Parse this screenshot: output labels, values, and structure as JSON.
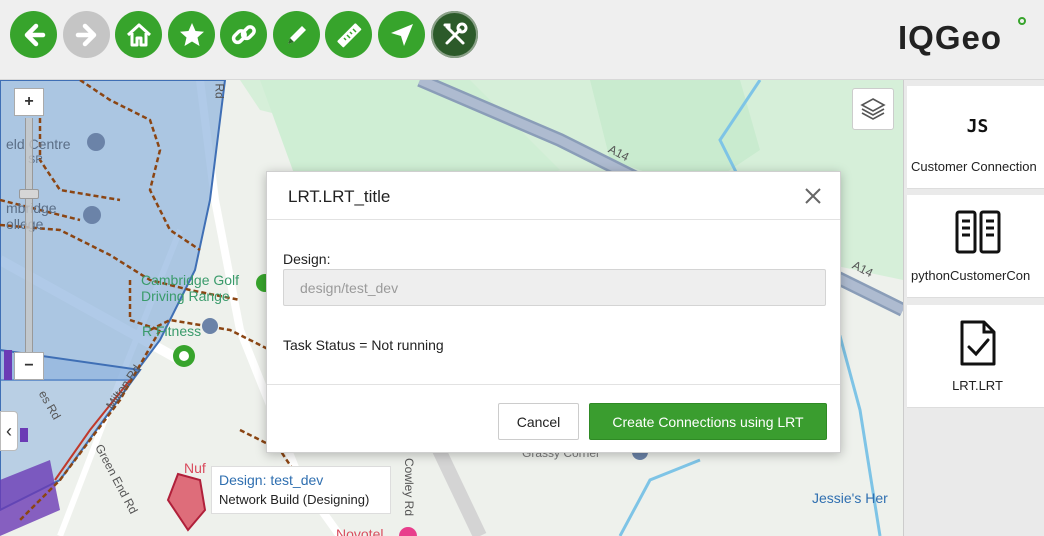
{
  "toolbar": {
    "buttons": [
      {
        "icon": "back-arrow-icon",
        "state": "enabled"
      },
      {
        "icon": "forward-arrow-icon",
        "state": "disabled"
      },
      {
        "icon": "home-icon",
        "state": "enabled"
      },
      {
        "icon": "star-icon",
        "state": "enabled"
      },
      {
        "icon": "link-icon",
        "state": "enabled"
      },
      {
        "icon": "pencil-icon",
        "state": "enabled"
      },
      {
        "icon": "ruler-icon",
        "state": "enabled"
      },
      {
        "icon": "navigate-arrow-icon",
        "state": "enabled"
      },
      {
        "icon": "tools-icon",
        "state": "active"
      }
    ],
    "logo_text": "IQGeo",
    "accent_color": "#37a42c"
  },
  "map": {
    "zoom_in": "+",
    "zoom_out": "−",
    "collapse_glyph": "‹",
    "labels": {
      "field_centre": "eld Centre",
      "sp": "SP",
      "cambridge": "mbridge",
      "college": "ollege",
      "golf": "Cambridge Golf",
      "driving": "Driving Range",
      "fitness": "R Fitness",
      "a14_1": "A14",
      "a14_2": "A14",
      "road_top": "Rd",
      "green_end": "Green End Rd",
      "milton": "Milton Rd",
      "cowley": "Cowley Rd",
      "grassy": "Grassy Corner",
      "jessie": "Jessie's Her",
      "nuf": "Nuf",
      "novotel": "Novotel",
      "c_label": "C",
      "res": "es Rd"
    },
    "tooltip": {
      "design_link": "Design: test_dev",
      "subtitle": "Network Build (Designing)"
    }
  },
  "right_panel": {
    "items": [
      {
        "icon": "js-icon",
        "icon_text": "JS",
        "label": "Customer Connection"
      },
      {
        "icon": "server-icon",
        "label": "pythonCustomerCon"
      },
      {
        "icon": "document-check-icon",
        "label": "LRT.LRT"
      }
    ]
  },
  "dialog": {
    "title": "LRT.LRT_title",
    "close_glyph": "✕",
    "design_label": "Design:",
    "design_value": "design/test_dev",
    "status_text": "Task Status = Not running",
    "cancel_label": "Cancel",
    "create_label": "Create Connections using LRT",
    "primary_color": "#3a9d2f"
  }
}
